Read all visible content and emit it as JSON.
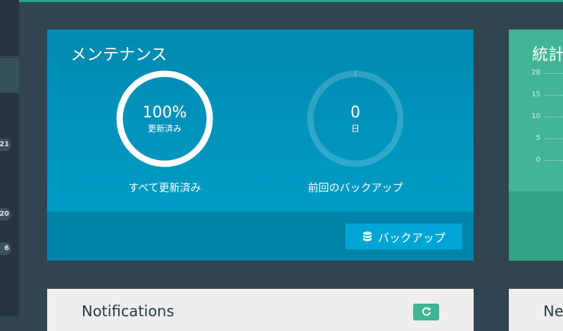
{
  "sidebar": {
    "badges": [
      "21",
      "20",
      "6"
    ]
  },
  "maintenance": {
    "title": "メンテナンス",
    "updates_gauge": {
      "value": "100%",
      "unit": "更新済み",
      "fraction": 1.0,
      "caption": "すべて更新済み"
    },
    "backup_gauge": {
      "value": "0",
      "unit": "日",
      "fraction": 0.0,
      "caption": "前回のバックアップ"
    },
    "backup_button": {
      "label": "バックアップ",
      "icon": "database-icon"
    }
  },
  "stats": {
    "title": "統計",
    "chart_data": {
      "type": "line",
      "title": "統計",
      "yticks": [
        "20",
        "15",
        "10",
        "5",
        "0"
      ],
      "ylim": [
        0,
        20
      ],
      "grid": true
    }
  },
  "notifications": {
    "title": "Notifications",
    "refresh_icon": "refresh-icon"
  },
  "news": {
    "title": "Ne"
  },
  "colors": {
    "accent": "#23a58a",
    "maintenance_panel": "#0096bd",
    "stats_panel": "#42b596",
    "button": "#00a5d5"
  }
}
